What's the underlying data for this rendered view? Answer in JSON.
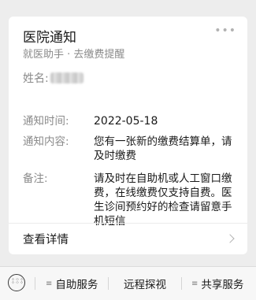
{
  "card": {
    "title": "医院通知",
    "subtitle": "就医助手 · 去缴费提醒",
    "more": "•••",
    "name_label": "姓名:",
    "fields": [
      {
        "label": "通知时间:",
        "value": "2022-05-18"
      },
      {
        "label": "通知内容:",
        "value": "您有一张新的缴费结算单，请及时缴费"
      },
      {
        "label": "备注:",
        "value": "请及时在自助机或人工窗口缴费，在线缴费仅支持自费。医生诊间预约好的检查请留意手机短信"
      }
    ],
    "details_label": "查看详情"
  },
  "bottom_menu": {
    "items": [
      {
        "label": "自助服务",
        "has_menu_icon": true
      },
      {
        "label": "远程探视",
        "has_menu_icon": false
      },
      {
        "label": "共享服务",
        "has_menu_icon": true
      }
    ]
  }
}
